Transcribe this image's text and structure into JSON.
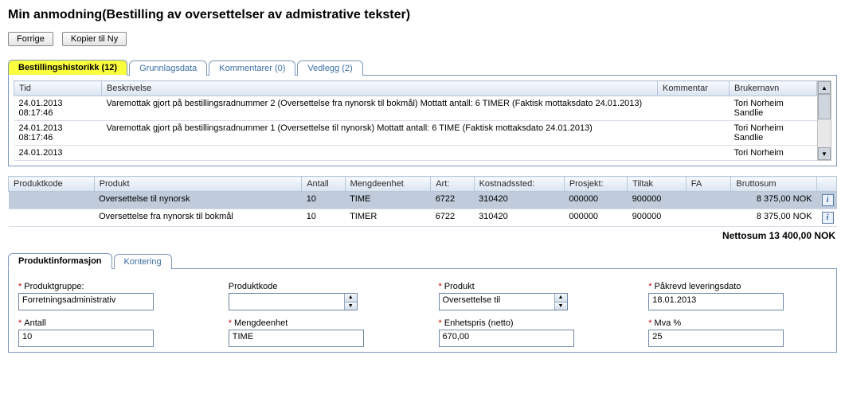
{
  "title": "Min anmodning(Bestilling av oversettelser av admistrative tekster)",
  "buttons": {
    "prev": "Forrige",
    "copyNew": "Kopier til Ny"
  },
  "tabs1": {
    "history": "Bestillingshistorikk (12)",
    "grunnlag": "Grunnlagsdata",
    "kommentarer": "Kommentarer (0)",
    "vedlegg": "Vedlegg (2)"
  },
  "historyHead": {
    "tid": "Tid",
    "besk": "Beskrivelse",
    "komm": "Kommentar",
    "bruker": "Brukernavn"
  },
  "historyRows": [
    {
      "tid": "24.01.2013 08:17:46",
      "besk": "Varemottak gjort på bestillingsradnummer 2 (Oversettelse fra nynorsk til bokmål) Mottatt antall: 6 TIMER (Faktisk mottaksdato 24.01.2013)",
      "komm": "",
      "bruker": "Tori Norheim Sandlie"
    },
    {
      "tid": "24.01.2013 08:17:46",
      "besk": "Varemottak gjort på bestillingsradnummer 1 (Oversettelse til nynorsk) Mottatt antall: 6 TIME (Faktisk mottaksdato 24.01.2013)",
      "komm": "",
      "bruker": "Tori Norheim Sandlie"
    },
    {
      "tid": "24.01.2013",
      "besk": "",
      "komm": "",
      "bruker": "Tori Norheim"
    }
  ],
  "prodHead": {
    "kode": "Produktkode",
    "prod": "Produkt",
    "antall": "Antall",
    "enhet": "Mengdeenhet",
    "art": "Art:",
    "kostn": "Kostnadssted:",
    "prosj": "Prosjekt:",
    "tiltak": "Tiltak",
    "fa": "FA",
    "brutto": "Bruttosum"
  },
  "prodRows": [
    {
      "kode": "",
      "prod": "Oversettelse til nynorsk",
      "antall": "10",
      "enhet": "TIME",
      "art": "6722",
      "kostn": "310420",
      "prosj": "000000",
      "tiltak": "900000",
      "fa": "",
      "brutto": "8 375,00 NOK"
    },
    {
      "kode": "",
      "prod": "Oversettelse fra nynorsk til bokmål",
      "antall": "10",
      "enhet": "TIMER",
      "art": "6722",
      "kostn": "310420",
      "prosj": "000000",
      "tiltak": "900000",
      "fa": "",
      "brutto": "8 375,00 NOK"
    }
  ],
  "nettosum": "Nettosum 13 400,00 NOK",
  "tabs2": {
    "prodinfo": "Produktinformasjon",
    "kontering": "Kontering"
  },
  "form": {
    "produktgruppe": {
      "label": "Produktgruppe:",
      "value": "Forretningsadministrativ"
    },
    "produktkode": {
      "label": "Produktkode",
      "value": ""
    },
    "produkt": {
      "label": "Produkt",
      "value": "Oversettelse til"
    },
    "levdato": {
      "label": "Påkrevd leveringsdato",
      "value": "18.01.2013"
    },
    "antall": {
      "label": "Antall",
      "value": "10"
    },
    "mengde": {
      "label": "Mengdeenhet",
      "value": "TIME"
    },
    "enhetspris": {
      "label": "Enhetspris (netto)",
      "value": "670,00"
    },
    "mva": {
      "label": "Mva %",
      "value": "25"
    }
  }
}
